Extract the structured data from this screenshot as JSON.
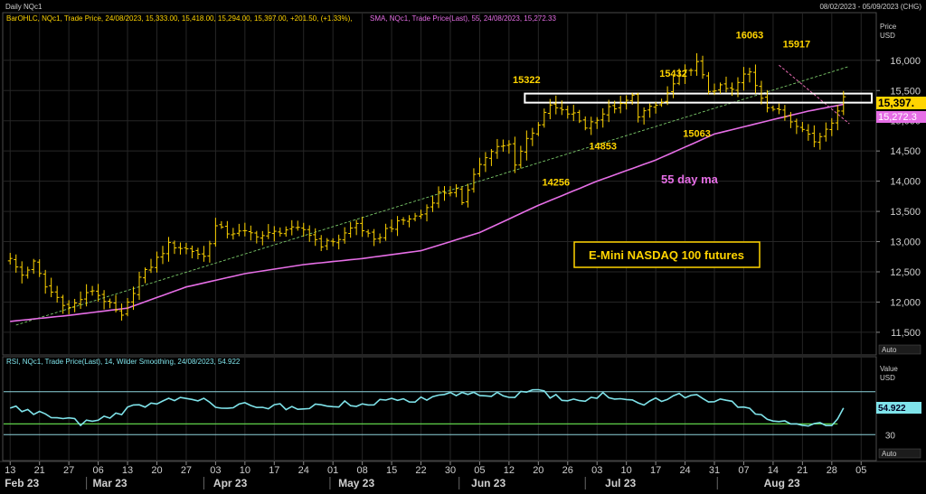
{
  "chart_data": {
    "type": "ohlc",
    "window_title": "Daily NQc1",
    "date_range_label": "08/02/2023 - 05/09/2023 (CHG)",
    "ohlc_legend": "BarOHLC, NQc1, Trade Price, 24/08/2023, 15,333.00, 15,418.00, 15,294.00, 15,397.00, +201.50, (+1.33%),",
    "sma_legend": "SMA, NQc1, Trade Price(Last),  55, 24/08/2023, 15,272.33",
    "rsi_legend": "RSI, NQc1, Trade Price(Last),  14, Wilder Smoothing, 24/08/2023, 54.922",
    "price_axis": {
      "label": "Price",
      "unit": "USD",
      "ylim": [
        11200,
        16550
      ],
      "ticks": [
        "16,000",
        "15,500",
        "15,000",
        "14,500",
        "14,000",
        "13,500",
        "13,000",
        "12,500",
        "12,000",
        "11,500"
      ],
      "tick_values": [
        16000,
        15500,
        15000,
        14500,
        14000,
        13500,
        13000,
        12500,
        12000,
        11500
      ],
      "auto_label": "Auto"
    },
    "rsi_axis": {
      "label": "Value",
      "unit": "USD",
      "ylim": [
        10,
        90
      ],
      "ticks": [
        "30"
      ],
      "tick_values": [
        30
      ],
      "auto_label": "Auto",
      "upper_band": 70,
      "lower_band": 30
    },
    "last_price_label": "15,397.",
    "sma_last_label": "15,272.3",
    "rsi_last_label": "54.922",
    "x_axis": {
      "day_ticks": [
        "13",
        "21",
        "27",
        "06",
        "13",
        "20",
        "27",
        "03",
        "10",
        "17",
        "24",
        "01",
        "08",
        "15",
        "22",
        "30",
        "05",
        "12",
        "20",
        "26",
        "03",
        "10",
        "17",
        "24",
        "31",
        "07",
        "14",
        "21",
        "28",
        "05"
      ],
      "month_labels": [
        "Feb 23",
        "Mar 23",
        "Apr 23",
        "May 23",
        "Jun 23",
        "Jul 23",
        "Aug 23"
      ]
    },
    "annotations": {
      "peaks": [
        {
          "text": "15322",
          "x": 88,
          "y": 15322
        },
        {
          "text": "15432",
          "x": 113,
          "y": 15432
        },
        {
          "text": "16063",
          "x": 126,
          "y": 16063
        },
        {
          "text": "15917",
          "x": 134,
          "y": 15917
        },
        {
          "text": "14853",
          "x": 101,
          "y": 14853
        },
        {
          "text": "15063",
          "x": 117,
          "y": 15063
        },
        {
          "text": "14256",
          "x": 93,
          "y": 14256
        }
      ],
      "sma_note": "55 day ma",
      "box_label": "E-Mini NASDAQ 100 futures"
    },
    "n_bars": 143,
    "close_anchors": [
      [
        0,
        12700
      ],
      [
        2,
        12450
      ],
      [
        4,
        12650
      ],
      [
        6,
        12250
      ],
      [
        10,
        11900
      ],
      [
        14,
        12200
      ],
      [
        17,
        11950
      ],
      [
        19,
        11750
      ],
      [
        22,
        12400
      ],
      [
        24,
        12600
      ],
      [
        27,
        12950
      ],
      [
        31,
        12850
      ],
      [
        33,
        12750
      ],
      [
        35,
        13250
      ],
      [
        37,
        13150
      ],
      [
        40,
        13150
      ],
      [
        43,
        13100
      ],
      [
        47,
        13200
      ],
      [
        50,
        13200
      ],
      [
        53,
        12950
      ],
      [
        56,
        13050
      ],
      [
        59,
        13300
      ],
      [
        62,
        13000
      ],
      [
        64,
        13200
      ],
      [
        67,
        13350
      ],
      [
        70,
        13450
      ],
      [
        73,
        13800
      ],
      [
        76,
        13850
      ],
      [
        77,
        13600
      ],
      [
        79,
        14150
      ],
      [
        81,
        14400
      ],
      [
        83,
        14550
      ],
      [
        85,
        14600
      ],
      [
        86,
        14300
      ],
      [
        88,
        14700
      ],
      [
        90,
        14950
      ],
      [
        92,
        15250
      ],
      [
        94,
        15150
      ],
      [
        96,
        15100
      ],
      [
        98,
        14900
      ],
      [
        100,
        15050
      ],
      [
        102,
        15200
      ],
      [
        104,
        15250
      ],
      [
        106,
        15400
      ],
      [
        107,
        15100
      ],
      [
        109,
        15200
      ],
      [
        111,
        15300
      ],
      [
        113,
        15600
      ],
      [
        115,
        15800
      ],
      [
        117,
        15950
      ],
      [
        119,
        15500
      ],
      [
        121,
        15550
      ],
      [
        123,
        15500
      ],
      [
        125,
        15750
      ],
      [
        126,
        15800
      ],
      [
        128,
        15400
      ],
      [
        129,
        15250
      ],
      [
        131,
        15150
      ],
      [
        133,
        15000
      ],
      [
        135,
        14900
      ],
      [
        137,
        14650
      ],
      [
        138,
        14750
      ],
      [
        140,
        15000
      ],
      [
        142,
        15397
      ]
    ],
    "sma_anchors": [
      [
        0,
        11680
      ],
      [
        10,
        11780
      ],
      [
        20,
        11900
      ],
      [
        30,
        12250
      ],
      [
        40,
        12470
      ],
      [
        50,
        12620
      ],
      [
        60,
        12720
      ],
      [
        70,
        12850
      ],
      [
        80,
        13150
      ],
      [
        90,
        13600
      ],
      [
        100,
        14000
      ],
      [
        110,
        14350
      ],
      [
        120,
        14780
      ],
      [
        130,
        15020
      ],
      [
        136,
        15160
      ],
      [
        142,
        15272
      ]
    ],
    "rsi_anchors": [
      [
        0,
        55
      ],
      [
        6,
        50
      ],
      [
        12,
        42
      ],
      [
        18,
        50
      ],
      [
        24,
        61
      ],
      [
        30,
        66
      ],
      [
        36,
        55
      ],
      [
        42,
        58
      ],
      [
        48,
        55
      ],
      [
        54,
        58
      ],
      [
        60,
        60
      ],
      [
        66,
        62
      ],
      [
        72,
        64
      ],
      [
        78,
        68
      ],
      [
        84,
        66
      ],
      [
        90,
        70
      ],
      [
        96,
        62
      ],
      [
        102,
        67
      ],
      [
        108,
        59
      ],
      [
        114,
        68
      ],
      [
        118,
        65
      ],
      [
        124,
        57
      ],
      [
        128,
        48
      ],
      [
        132,
        44
      ],
      [
        136,
        40
      ],
      [
        140,
        36
      ],
      [
        142,
        55
      ]
    ],
    "trendline_up": [
      [
        1,
        11620
      ],
      [
        143,
        15900
      ]
    ],
    "trendline_down": [
      [
        131,
        15920
      ],
      [
        143,
        14950
      ]
    ],
    "resistance_box": [
      15300,
      15450
    ],
    "rsi_signal_level": 40,
    "colors": {
      "background": "#000000",
      "ohlc": "#ffd400",
      "sma": "#e66ee6",
      "rsi": "#7fe3ea",
      "rsi_band": "#8ed3dc",
      "rsi_signal": "#5fd14a",
      "trend_up": "#7bc96a",
      "trend_down": "#e86ab2",
      "grid": "#262626",
      "panel_border": "#4a4a4a"
    }
  }
}
